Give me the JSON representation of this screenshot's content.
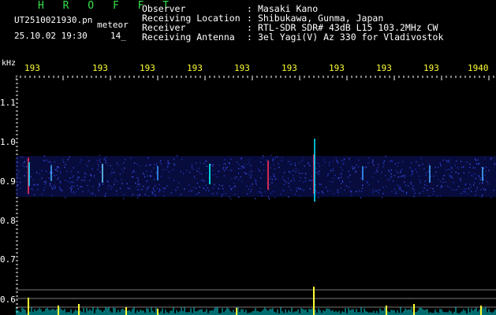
{
  "header": {
    "brand": "H R O F F T",
    "filename": "UT2510021930.pn",
    "meteor_label": "meteor",
    "datetime": "25.10.02 19:30",
    "count": "14_"
  },
  "metadata": [
    {
      "key": "Observer",
      "value": "Masaki Kano"
    },
    {
      "key": "Receiving Location",
      "value": "Shibukawa, Gunma, Japan"
    },
    {
      "key": "Receiver",
      "value": "RTL-SDR SDR# 43dB L15 103.2MHz CW"
    },
    {
      "key": "Receiving Antenna",
      "value": "3el Yagi(V) Az 330 for Vladivostok"
    }
  ],
  "axis": {
    "y_unit": "kHz",
    "y_ticks": [
      "1.1",
      "1.0",
      "0.9",
      "0.8",
      "0.7",
      "0.6"
    ],
    "x_ticks": [
      "193",
      "193",
      "193",
      "193",
      "193",
      "193",
      "193",
      "193",
      "193",
      "1940"
    ]
  },
  "colors": {
    "brand": "#35e24a",
    "text": "#ffffff",
    "accent": "#ffff33",
    "band": "#1a2a9a",
    "signal": "#00ffff"
  }
}
